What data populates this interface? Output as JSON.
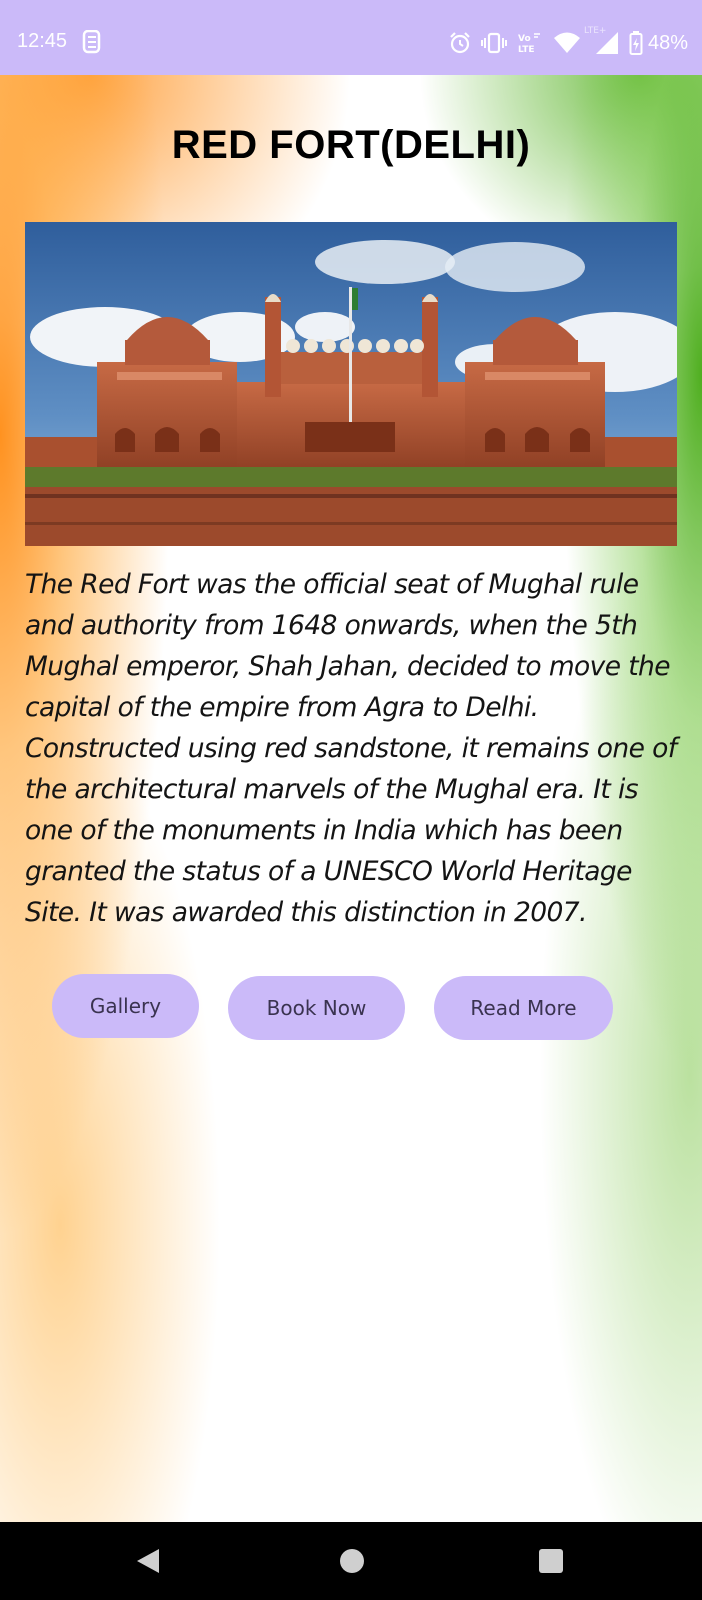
{
  "status_bar": {
    "time": "12:45",
    "network_label_top": "Vo",
    "network_label_bottom": "LTE",
    "secondary_network": "LTE+",
    "battery": "48%",
    "icons": [
      "sync-app-icon",
      "alarm-icon",
      "vibrate-icon",
      "volte-icon",
      "wifi-icon",
      "cell-signal-icon",
      "battery-icon"
    ]
  },
  "page": {
    "title": "RED FORT(DELHI)",
    "description": "The Red Fort was the official seat of Mughal rule and authority from 1648 onwards, when the 5th Mughal emperor, Shah Jahan, decided to move the capital of the empire from Agra to Delhi. Constructed using red sandstone, it remains one of the architectural marvels of the Mughal era. It is one of the monuments in India which has been granted the status of a UNESCO World Heritage Site. It was awarded this distinction in 2007."
  },
  "buttons": {
    "gallery": "Gallery",
    "book_now": "Book Now",
    "read_more": "Read More"
  },
  "colors": {
    "accent": "#cbbaf9",
    "button_text": "#3a3350",
    "saffron": "#ff8c14",
    "green": "#46aa14"
  },
  "nav_bar": {
    "icons": [
      "back-icon",
      "home-icon",
      "recents-icon"
    ]
  }
}
